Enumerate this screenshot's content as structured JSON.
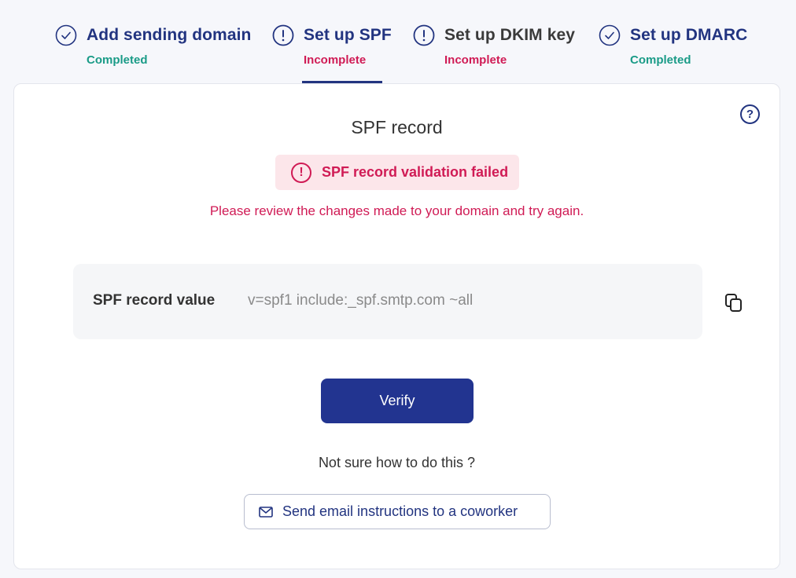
{
  "steps": [
    {
      "title": "Add sending domain",
      "status": "Completed",
      "state": "complete",
      "icon": "check-circle-icon"
    },
    {
      "title": "Set up SPF",
      "status": "Incomplete",
      "state": "incomplete",
      "icon": "alert-circle-icon",
      "active": true
    },
    {
      "title": "Set up DKIM key",
      "status": "Incomplete",
      "state": "incomplete",
      "icon": "alert-circle-icon"
    },
    {
      "title": "Set up DMARC",
      "status": "Completed",
      "state": "complete",
      "icon": "check-circle-icon"
    }
  ],
  "card": {
    "title": "SPF record",
    "help_icon": "question-circle-icon",
    "help_glyph": "?",
    "alert": {
      "glyph": "!",
      "text": "SPF record validation failed",
      "description": "Please review the changes made to your domain and try again."
    },
    "record": {
      "label": "SPF record value",
      "value": "v=spf1 include:_spf.smtp.com ~all",
      "copy_icon": "copy-icon"
    },
    "verify_label": "Verify",
    "hint": "Not sure how to do this ?",
    "email_button": {
      "label": "Send email instructions to a coworker",
      "icon": "mail-icon"
    }
  },
  "colors": {
    "primary": "#223480",
    "success": "#1a9b87",
    "error": "#d01b55",
    "error_bg": "#fce6ea"
  }
}
